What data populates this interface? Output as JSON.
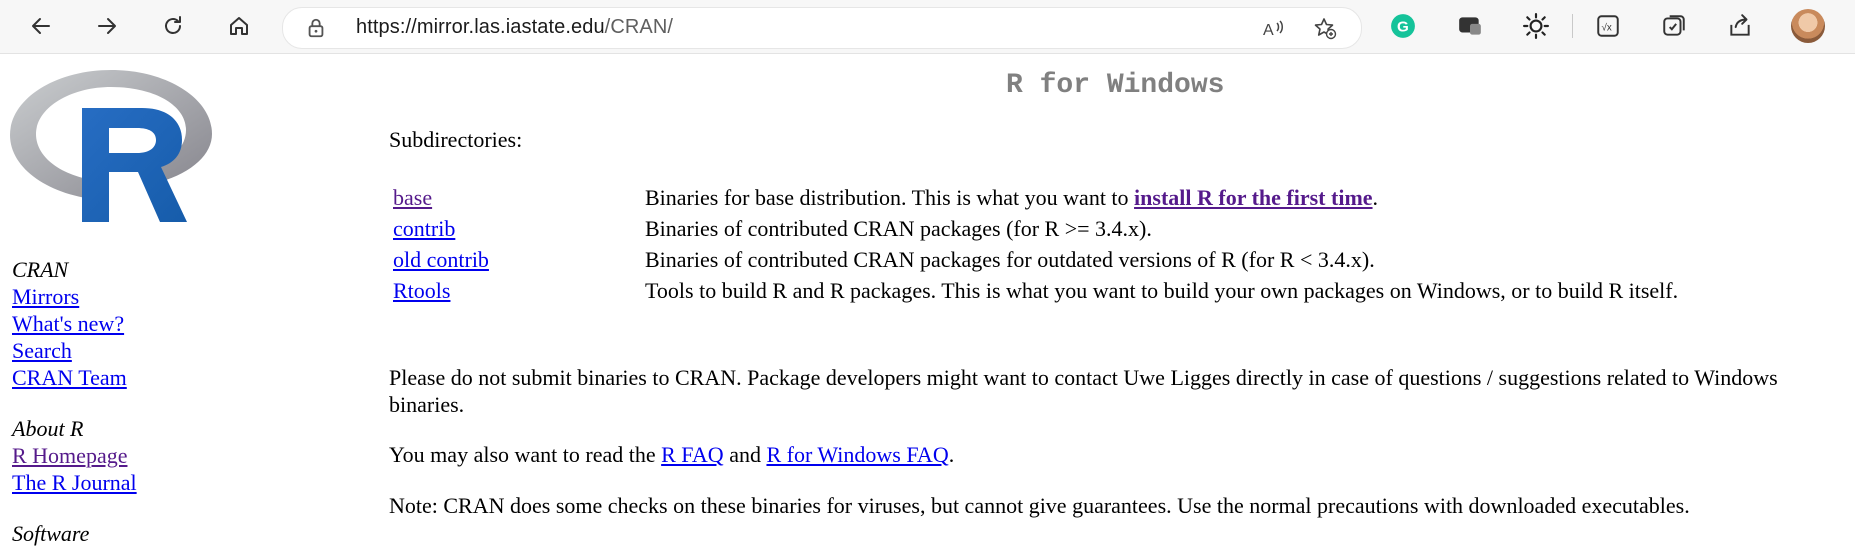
{
  "browser": {
    "url_host": "https://mirror.las.iastate.edu",
    "url_path": "/CRAN/"
  },
  "sidebar": {
    "section1_head": "CRAN",
    "section1_links": [
      "Mirrors",
      "What's new?",
      "Search",
      "CRAN Team"
    ],
    "section2_head": "About R",
    "section2_links": [
      "R Homepage",
      "The R Journal"
    ],
    "section3_head": "Software"
  },
  "main": {
    "title": "R for Windows",
    "subdirectories_label": "Subdirectories:",
    "rows": [
      {
        "name": "base",
        "desc_pre": "Binaries for base distribution. This is what you want to ",
        "desc_link": "install R for the first time",
        "desc_post": "."
      },
      {
        "name": "contrib",
        "desc": "Binaries of contributed CRAN packages (for R >= 3.4.x)."
      },
      {
        "name": "old contrib",
        "desc": "Binaries of contributed CRAN packages for outdated versions of R (for R < 3.4.x)."
      },
      {
        "name": "Rtools",
        "desc": "Tools to build R and R packages. This is what you want to build your own packages on Windows, or to build R itself."
      }
    ],
    "para1": "Please do not submit binaries to CRAN. Package developers might want to contact Uwe Ligges directly in case of questions / suggestions related to Windows binaries.",
    "para2_pre": "You may also want to read the ",
    "para2_link1": "R FAQ",
    "para2_mid": " and ",
    "para2_link2": "R for Windows FAQ",
    "para2_post": ".",
    "para3": "Note: CRAN does some checks on these binaries for viruses, but cannot give guarantees. Use the normal precautions with downloaded executables."
  }
}
